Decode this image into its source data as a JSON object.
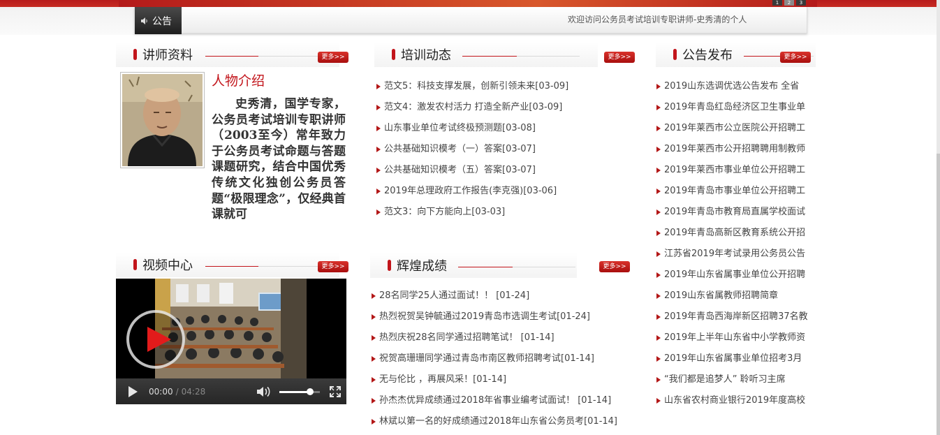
{
  "banner": {
    "pager": [
      "1",
      "2",
      "3"
    ]
  },
  "notice": {
    "label": "公告",
    "text": "欢迎访问公务员考试培训专职讲师-史秀清的个人"
  },
  "sections": {
    "teacher": {
      "title": "讲师资料",
      "more": "更多>>"
    },
    "training": {
      "title": "培训动态",
      "more": "更多>>"
    },
    "announce": {
      "title": "公告发布",
      "more": "更多>>"
    },
    "video": {
      "title": "视频中心",
      "more": "更多>>"
    },
    "results": {
      "title": "辉煌成绩",
      "more": "更多>>"
    }
  },
  "profile": {
    "heading": "人物介绍",
    "text": "史秀清，国学专家，公务员考试培训专职讲师（2003至今）常年致力于公务员考试命题与答题课题研究，结合中国优秀传统文化独创公务员答题“极限理念”，仅经典首课就可"
  },
  "training_items": [
    "范文5：科技支撑发展，创新引领未来[03-09]",
    "范文4：激发农村活力 打造全新产业[03-09]",
    "山东事业单位考试终极预测题[03-08]",
    "公共基础知识模考（一）答案[03-07]",
    "公共基础知识模考（五）答案[03-07]",
    "2019年总理政府工作报告(李克强)[03-06]",
    "范文3：向下方能向上[03-03]"
  ],
  "results_items": [
    "28名同学25人通过面试！！ [01-24]",
    "热烈祝贺吴钟毓通过2019青岛市选调生考试[01-24]",
    "热烈庆祝28名同学通过招聘笔试！ [01-14]",
    "祝贺高珊珊同学通过青岛市南区教师招聘考试[01-14]",
    "无与伦比 ，再展风采！[01-14]",
    "孙杰杰优异成绩通过2018年省事业编考试面试！ [01-14]",
    "林斌以第一名的好成绩通过2018年山东省公务员考[01-14]"
  ],
  "announce_items": [
    "2019山东选调优选公告发布 全省",
    "2019年青岛红岛经济区卫生事业单",
    "2019年莱西市公立医院公开招聘工",
    "2019年莱西市公开招聘聘用制教师",
    "2019年莱西市事业单位公开招聘工",
    "2019年青岛市事业单位公开招聘工",
    "2019年青岛市教育局直属学校面试",
    "2019年青岛高新区教育系统公开招",
    "江苏省2019年考试录用公务员公告",
    "2019年山东省属事业单位公开招聘",
    "2019山东省属教师招聘简章",
    "2019年青岛西海岸新区招聘37名教",
    "2019年上半年山东省中小学教师资",
    "2019年山东省属事业单位招考3月",
    "“我们都是追梦人” 聆听习主席",
    "山东省农村商业银行2019年度高校"
  ],
  "video": {
    "current_time": "00:00",
    "separator": "/",
    "duration": "04:28",
    "volume": 0.75,
    "play_icon": "play-icon",
    "volume_icon": "volume-icon",
    "fullscreen_icon": "fullscreen-icon"
  },
  "colors": {
    "brand_red": "#c2151b",
    "more_button": "#b81a1a"
  }
}
